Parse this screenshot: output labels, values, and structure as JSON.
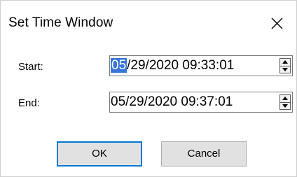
{
  "dialog": {
    "title": "Set Time Window",
    "close_icon": "close-icon"
  },
  "fields": [
    {
      "label": "Start:",
      "selected_segment": "05",
      "rest": "/29/2020 09:33:01",
      "value": "05/29/2020 09:33:01"
    },
    {
      "label": "End:",
      "value": "05/29/2020 09:37:01"
    }
  ],
  "buttons": {
    "ok": "OK",
    "cancel": "Cancel"
  },
  "colors": {
    "selection": "#3875d7",
    "default_button_border": "#0078d7",
    "button_face": "#e1e1e1"
  }
}
